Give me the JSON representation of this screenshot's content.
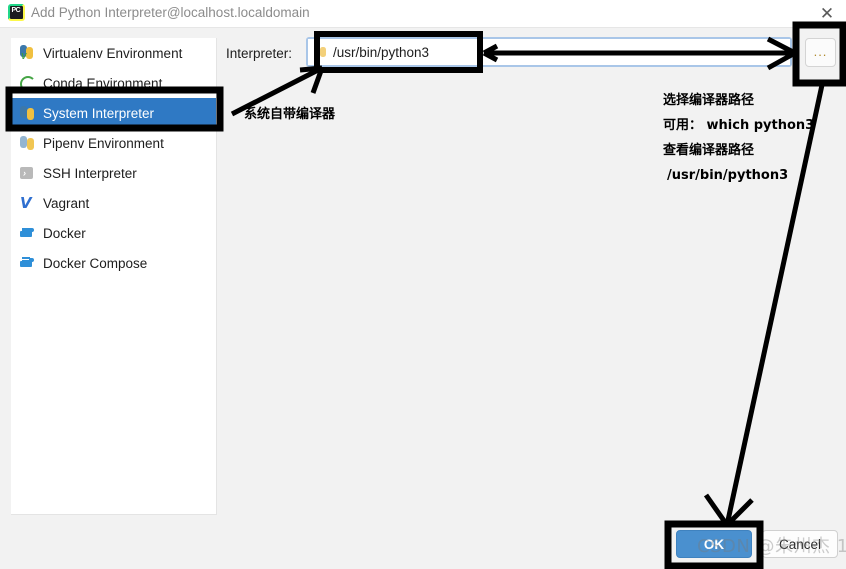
{
  "window": {
    "title": "Add Python Interpreter@localhost.localdomain",
    "icon": "pycharm-icon",
    "close_label": "✕"
  },
  "sidebar": {
    "items": [
      {
        "label": "Virtualenv Environment",
        "icon": "virtualenv-icon",
        "selected": false
      },
      {
        "label": "Conda Environment",
        "icon": "conda-icon",
        "selected": false
      },
      {
        "label": "System Interpreter",
        "icon": "python-icon",
        "selected": true
      },
      {
        "label": "Pipenv Environment",
        "icon": "pipenv-icon",
        "selected": false
      },
      {
        "label": "SSH Interpreter",
        "icon": "ssh-icon",
        "selected": false
      },
      {
        "label": "Vagrant",
        "icon": "vagrant-icon",
        "selected": false
      },
      {
        "label": "Docker",
        "icon": "docker-icon",
        "selected": false
      },
      {
        "label": "Docker Compose",
        "icon": "docker-compose-icon",
        "selected": false
      }
    ]
  },
  "main": {
    "interpreter_label": "Interpreter:",
    "interpreter_value": "/usr/bin/python3",
    "interpreter_icon": "python-icon",
    "browse_button_label": "...",
    "browse_button_icon": "ellipsis-icon"
  },
  "footer": {
    "ok_label": "OK",
    "cancel_label": "Cancel"
  },
  "annotations": {
    "system_interpreter_note": "系统自带编译器",
    "line1": "选择编译器路径",
    "line2": "可用： which python3",
    "line3": "查看编译器路径",
    "line4": "/usr/bin/python3"
  },
  "watermark": {
    "text": "CSDN @朱州杰 1"
  },
  "colors": {
    "selection_blue": "#2f79c4",
    "ok_button_blue": "#4a90cf",
    "focus_ring": "#a9c6e8",
    "window_bg": "#f2f2f2",
    "panel_bg": "#ffffff",
    "annotation": "#000000"
  }
}
